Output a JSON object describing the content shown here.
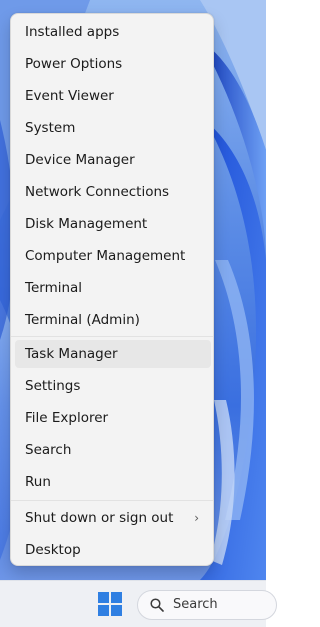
{
  "menu": {
    "items": [
      {
        "label": "Installed apps"
      },
      {
        "label": "Power Options"
      },
      {
        "label": "Event Viewer"
      },
      {
        "label": "System"
      },
      {
        "label": "Device Manager"
      },
      {
        "label": "Network Connections"
      },
      {
        "label": "Disk Management"
      },
      {
        "label": "Computer Management"
      },
      {
        "label": "Terminal"
      },
      {
        "label": "Terminal (Admin)"
      },
      {
        "label": "Task Manager",
        "highlighted": true
      },
      {
        "label": "Settings"
      },
      {
        "label": "File Explorer"
      },
      {
        "label": "Search"
      },
      {
        "label": "Run"
      },
      {
        "label": "Shut down or sign out",
        "submenu": true
      },
      {
        "label": "Desktop"
      }
    ],
    "submenu_chevron": "›"
  },
  "taskbar": {
    "search_label": "Search",
    "start_icon": "windows-logo-icon",
    "search_icon": "search-icon"
  },
  "colors": {
    "menu_background": "#f3f3f3",
    "highlight": "#e7e7e7",
    "windows_blue": "#2f7fe2"
  }
}
